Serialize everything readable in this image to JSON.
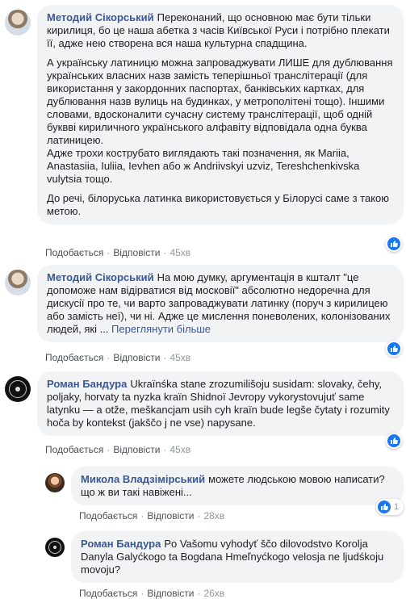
{
  "comments": [
    {
      "author": "Методий Сікорський",
      "paragraphs": [
        "Переконаний, що основною має бути тільки кирилиця, бо це наша абетка з часів Київської Руси і потрібно плекати її, адже нею створена вся наша культурна спадщина.",
        "А українську латиницю можна запроваджувати ЛИШЕ для дублювання українських власних назв замість теперішньої транслітерації (для використання у закордонних паспортах, банківських картках, для дублювання назв вулиць на будинках, у метрополітені тощо). Іншими словами, вдосконалити сучасну систему транслітерації, щоб одній буквві кириличного українського алфавіту відповідала одна буква латиницею.\nАдже трохи кострубато виглядають такі позначення, як Mariia, Anastasiia, Iuliia, Ievhen або ж Andriivskyi uzviz, Tereshchenkivska vulytsia тощо.",
        "До речі, білоруська латинка використовується у Білорусі саме з такою метою."
      ],
      "like_label": "Подобається",
      "reply_label": "Відповісти",
      "time": "45хв",
      "reaction_icon": "like-icon"
    },
    {
      "author": "Методий Сікорський",
      "paragraphs": [
        "На мою думку, аргументація в кшталт \"це допоможе нам відірватися від московії\" абсолютно недоречна для дискусії про те, чи варто запроваджувати латинку (поруч з кирилицею або замість неї), чи ні. Адже це мислення поневолених, колонізованих людей, які ..."
      ],
      "see_more": "Переглянути більше",
      "like_label": "Подобається",
      "reply_label": "Відповісти",
      "time": "45хв",
      "reaction_icon": "like-icon"
    },
    {
      "author": "Роман Бандура",
      "paragraphs": [
        "Ukraïnśka stane zrozumilišoju susidam: slovaky, čehy, poljaky, horvaty ta nyzka kraïn Shidnoï Jevropy vykorystovujuť same latynku — a otže, meškancjam usih cyh kraïn bude legše čytaty i rozumity hoča by kontekst (jakščo j ne vse) napysane."
      ],
      "like_label": "Подобається",
      "reply_label": "Відповісти",
      "time": "45хв",
      "reaction_icon": "like-icon"
    },
    {
      "author": "Микола Владзімірський",
      "paragraphs": [
        "можете людською мовою написати? що ж ви такі навіжені..."
      ],
      "like_label": "Подобається",
      "reply_label": "Відповісти",
      "time": "28хв",
      "reaction_icon": "like-icon",
      "reaction_count": "1"
    },
    {
      "author": "Роман Бандура",
      "paragraphs": [
        "Po Vašomu vyhodyť ščo dilovodstvo Korolja Danyla Galyćkogo ta Bogdana Hmeľnyćkogo velosja ne ljudśkoju movoju?"
      ],
      "like_label": "Подобається",
      "reply_label": "Відповісти",
      "time": "26хв"
    }
  ]
}
